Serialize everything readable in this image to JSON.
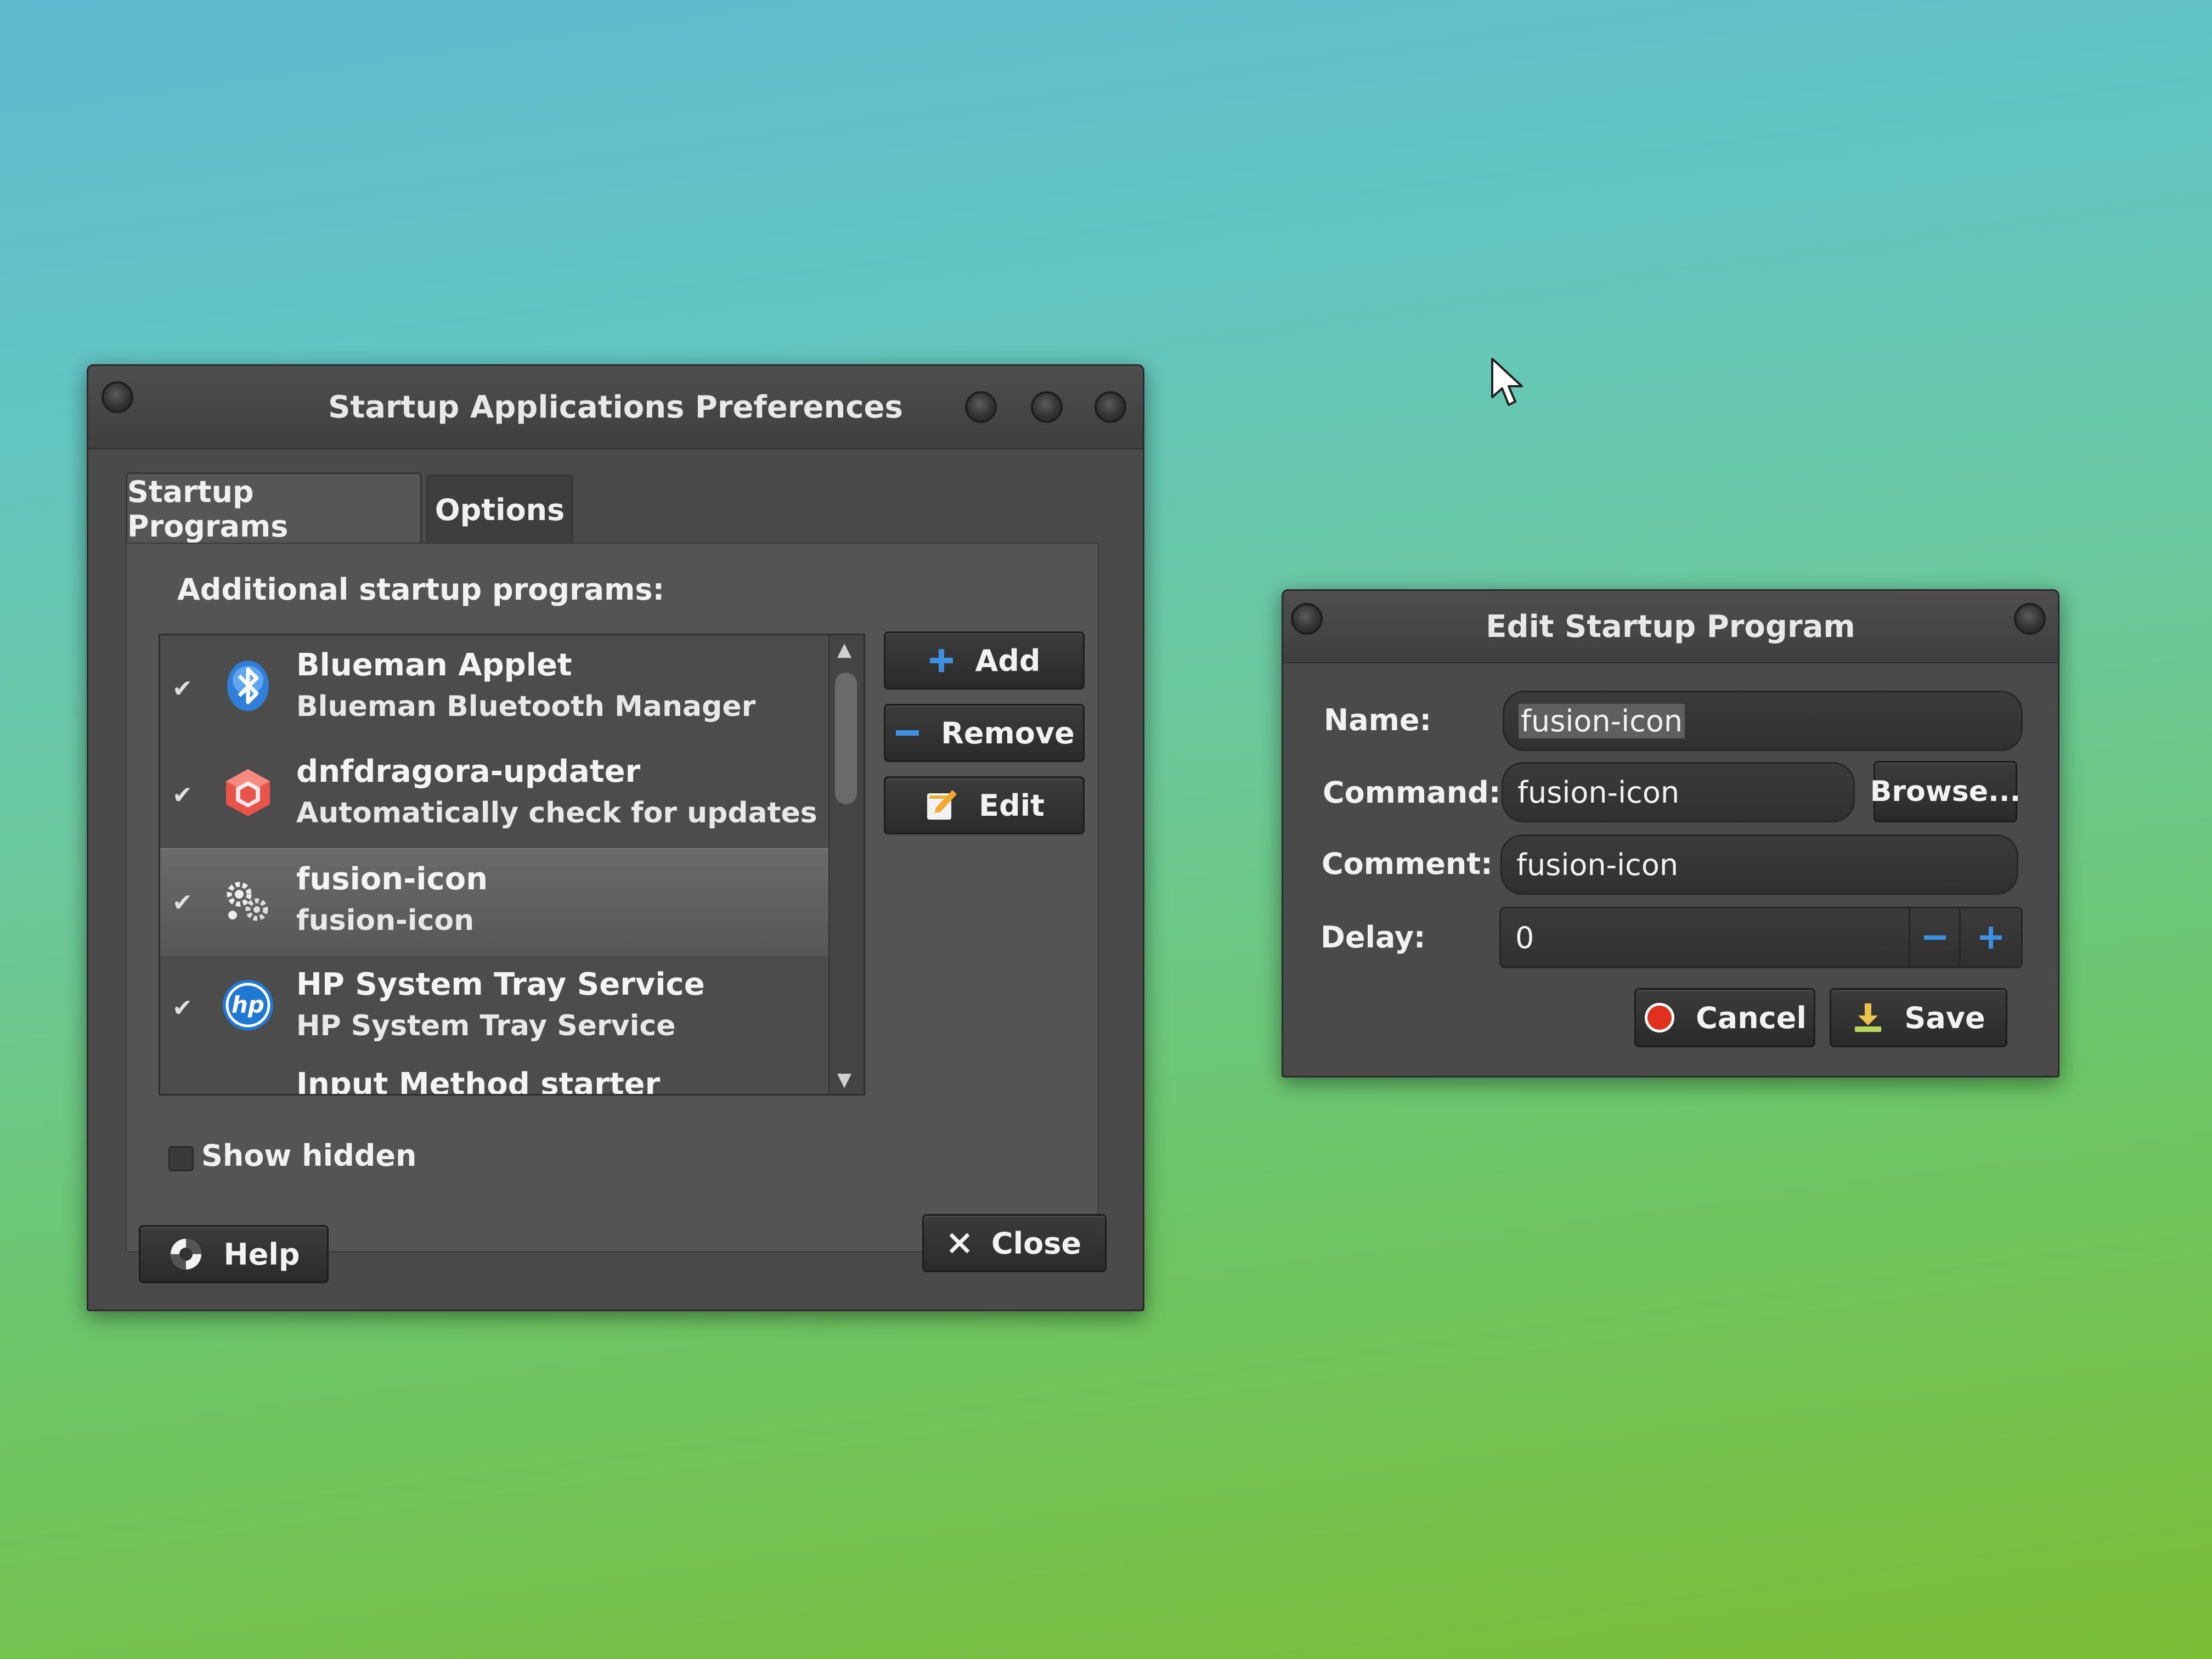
{
  "startup_window": {
    "title": "Startup Applications Preferences",
    "tabs": [
      {
        "label": "Startup Programs",
        "active": true
      },
      {
        "label": "Options",
        "active": false
      }
    ],
    "section_label": "Additional startup programs:",
    "programs": [
      {
        "enabled": true,
        "name": "Blueman Applet",
        "description": "Blueman Bluetooth Manager",
        "icon": "bluetooth-icon"
      },
      {
        "enabled": true,
        "name": "dnfdragora-updater",
        "description": "Automatically check for updates an...",
        "icon": "package-icon"
      },
      {
        "enabled": true,
        "name": "fusion-icon",
        "description": "fusion-icon",
        "icon": "gears-icon",
        "selected": true
      },
      {
        "enabled": true,
        "name": "HP System Tray Service",
        "description": "HP System Tray Service",
        "icon": "hp-icon"
      },
      {
        "enabled": true,
        "name": "Input Method starter",
        "description": "",
        "icon": "keyboard-icon"
      }
    ],
    "buttons": {
      "add": "Add",
      "remove": "Remove",
      "edit": "Edit",
      "help": "Help",
      "close": "Close"
    },
    "show_hidden_label": "Show hidden",
    "check_glyph": "✔"
  },
  "edit_dialog": {
    "title": "Edit Startup Program",
    "labels": {
      "name": "Name:",
      "command": "Command:",
      "comment": "Comment:",
      "delay": "Delay:"
    },
    "values": {
      "name": "fusion-icon",
      "command": "fusion-icon",
      "comment": "fusion-icon",
      "delay": "0"
    },
    "buttons": {
      "browse": "Browse...",
      "cancel": "Cancel",
      "save": "Save"
    }
  },
  "colors": {
    "accent_blue": "#3d8fe0",
    "cancel_red": "#e0301e",
    "save_green": "#b7d65a"
  }
}
